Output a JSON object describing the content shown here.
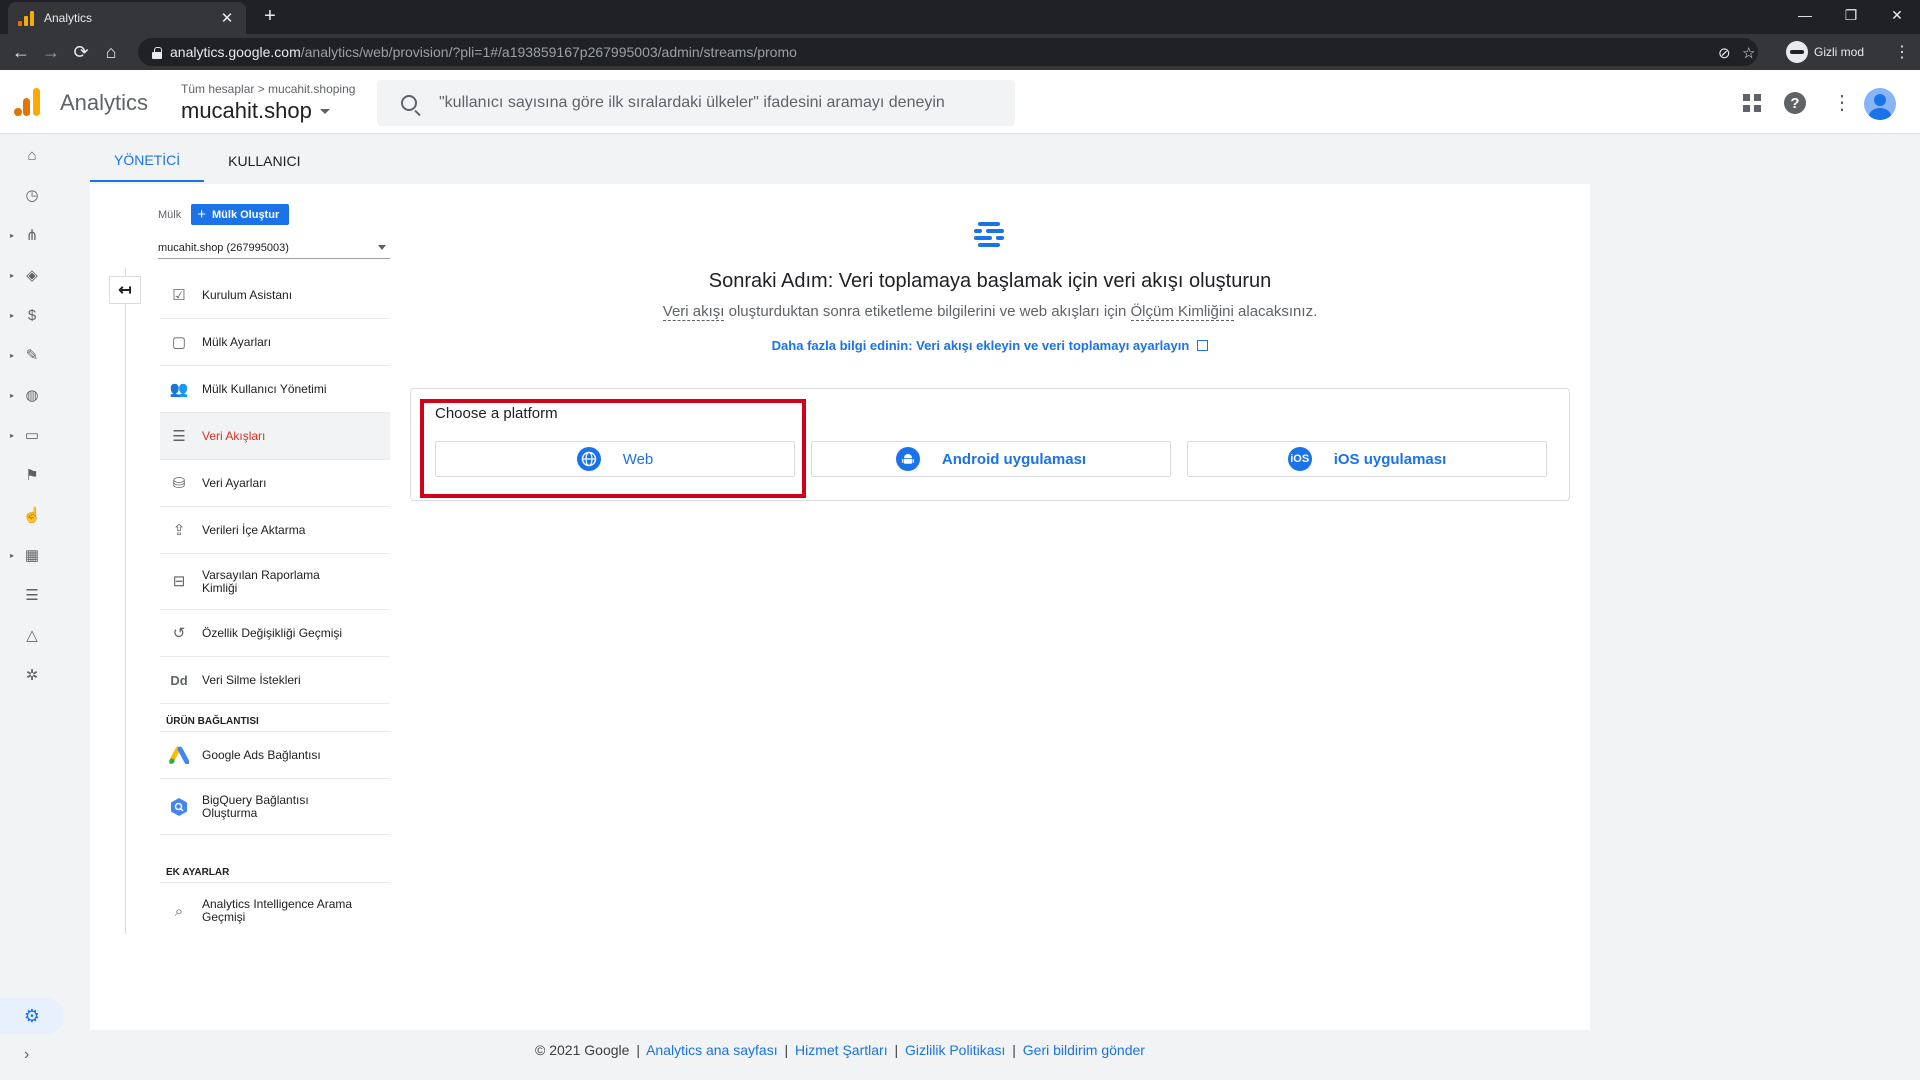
{
  "browser": {
    "tab_title": "Analytics",
    "tab_close": "✕",
    "new_tab": "+",
    "url_host": "analytics.google.com",
    "url_path": "/analytics/web/provision/?pli=1#/a193859167p267995003/admin/streams/promo",
    "incognito_label": "Gizli mod",
    "window_controls": [
      "—",
      "❐",
      "✕"
    ]
  },
  "header": {
    "app_name": "Analytics",
    "breadcrumb": "Tüm hesaplar  >  mucahit.shoping",
    "property_name": "mucahit.shop",
    "search_placeholder": "\"kullanıcı sayısına göre ilk sıralardaki ülkeler\" ifadesini aramayı deneyin"
  },
  "admin_tabs": [
    "YÖNETİCİ",
    "KULLANICI"
  ],
  "property_panel": {
    "label": "Mülk",
    "create_button": "Mülk Oluştur",
    "selected_property": "mucahit.shop (267995003)"
  },
  "menu": {
    "items": [
      "Kurulum Asistanı",
      "Mülk Ayarları",
      "Mülk Kullanıcı Yönetimi",
      "Veri Akışları",
      "Veri Ayarları",
      "Verileri İçe Aktarma",
      "Varsayılan Raporlama Kimliği",
      "Özellik Değişikliği Geçmişi",
      "Veri Silme İstekleri"
    ],
    "section_product": "ÜRÜN BAĞLANTISI",
    "product_items": [
      "Google Ads Bağlantısı",
      "BigQuery Bağlantısı Oluşturma"
    ],
    "section_extra": "EK AYARLAR",
    "extra_items": [
      "Analytics Intelligence Arama Geçmişi"
    ]
  },
  "content": {
    "title": "Sonraki Adım: Veri toplamaya başlamak için veri akışı oluşturun",
    "subtitle_a": "Veri akışı",
    "subtitle_b": " oluşturduktan sonra etiketleme bilgilerini ve web akışları için ",
    "subtitle_c": "Ölçüm Kimliğini",
    "subtitle_d": " alacaksınız.",
    "learn_more": "Daha fazla bilgi edinin: Veri akışı ekleyin ve veri toplamayı ayarlayın",
    "platform_label": "Choose a platform",
    "platforms": [
      "Web",
      "Android uygulaması",
      "iOS uygulaması"
    ]
  },
  "footer": {
    "copyright": "© 2021 Google",
    "links": [
      "Analytics ana sayfası",
      "Hizmet Şartları",
      "Gizlilik Politikası",
      "Geri bildirim gönder"
    ]
  },
  "colors": {
    "accent": "#1a73e8",
    "active_menu_text": "#d93025",
    "highlight_border": "#d0021b",
    "logo_orange": "#e37400",
    "logo_yellow": "#f9ab00"
  }
}
